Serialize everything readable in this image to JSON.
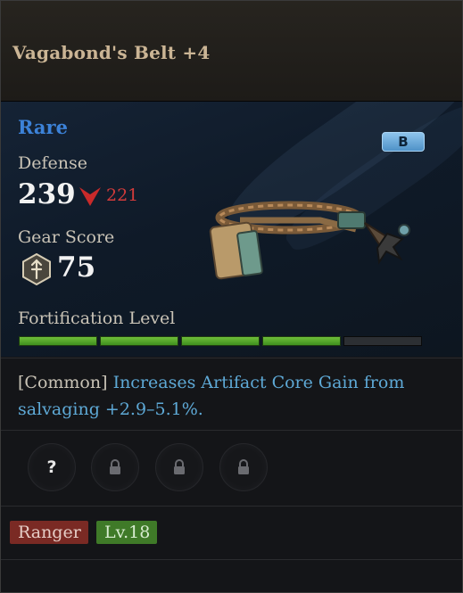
{
  "item": {
    "name": "Vagabond's Belt +4",
    "rarity": "Rare",
    "grade": "B",
    "rarity_color": "#3c82d8"
  },
  "stats": {
    "defense_label": "Defense",
    "defense_value": "239",
    "defense_compare": "221",
    "compare_indicator": "down-arrow-icon",
    "gear_score_label": "Gear Score",
    "gear_score_icon": "gear-score-icon",
    "gear_score_value": "75"
  },
  "fortification": {
    "label": "Fortification Level",
    "filled": 4,
    "total": 5,
    "fill_color": "#5aa52e"
  },
  "effect": {
    "prefix": "[Common]",
    "description": "Increases Artifact Core Gain from salvaging +2.9–5.1%."
  },
  "sockets": [
    {
      "state": "unknown",
      "symbol": "?"
    },
    {
      "state": "locked",
      "icon": "lock-icon"
    },
    {
      "state": "locked",
      "icon": "lock-icon"
    },
    {
      "state": "locked",
      "icon": "lock-icon"
    }
  ],
  "requirements": {
    "class": "Ranger",
    "level": "Lv.18",
    "class_color": "#7a2a24",
    "level_color": "#3f7a28"
  }
}
